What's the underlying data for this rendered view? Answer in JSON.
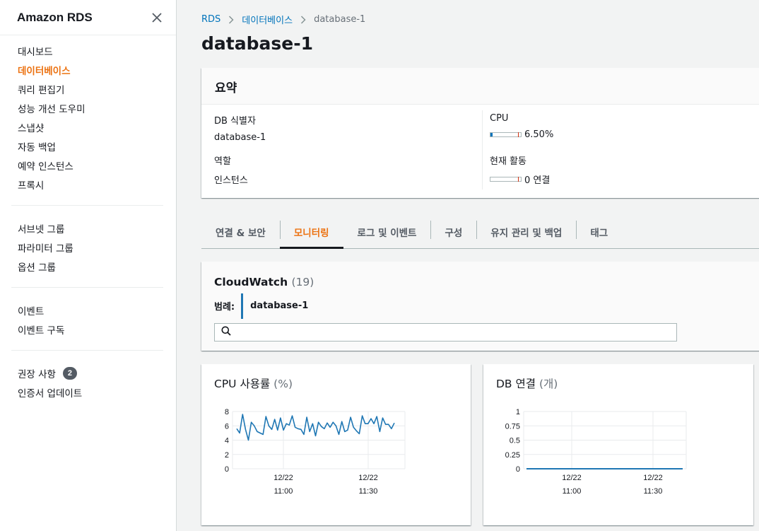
{
  "sidebar": {
    "title": "Amazon RDS",
    "groups": [
      [
        {
          "label": "대시보드"
        },
        {
          "label": "데이터베이스",
          "active": true
        },
        {
          "label": "쿼리 편집기"
        },
        {
          "label": "성능 개선 도우미"
        },
        {
          "label": "스냅샷"
        },
        {
          "label": "자동 백업"
        },
        {
          "label": "예약 인스턴스"
        },
        {
          "label": "프록시"
        }
      ],
      [
        {
          "label": "서브넷 그룹"
        },
        {
          "label": "파라미터 그룹"
        },
        {
          "label": "옵션 그룹"
        }
      ],
      [
        {
          "label": "이벤트"
        },
        {
          "label": "이벤트 구독"
        }
      ],
      [
        {
          "label": "권장 사항",
          "badge": "2"
        },
        {
          "label": "인증서 업데이트"
        }
      ]
    ]
  },
  "breadcrumb": {
    "items": [
      "RDS",
      "데이터베이스"
    ],
    "current": "database-1"
  },
  "page_title": "database-1",
  "summary": {
    "title": "요약",
    "db_id_label": "DB 식별자",
    "db_id_value": "database-1",
    "role_label": "역할",
    "role_value": "인스턴스",
    "cpu_label": "CPU",
    "cpu_value": "6.50%",
    "cpu_fraction": 0.065,
    "activity_label": "현재 활동",
    "activity_value": "0 연결",
    "activity_fraction": 0
  },
  "tabs": [
    {
      "label": "연결 & 보안"
    },
    {
      "label": "모니터링",
      "active": true
    },
    {
      "label": "로그 및 이벤트"
    },
    {
      "label": "구성"
    },
    {
      "label": "유지 관리 및 백업"
    },
    {
      "label": "태그"
    }
  ],
  "cloudwatch": {
    "title": "CloudWatch",
    "count": "(19)",
    "legend_label": "범례:",
    "legend_item": "database-1",
    "search_placeholder": ""
  },
  "colors": {
    "accent": "#ec7211",
    "link": "#0073bb",
    "series": "#1f77b4"
  },
  "chart_data": [
    {
      "type": "line",
      "title": "CPU 사용률",
      "unit": "(%)",
      "yticks": [
        "8",
        "6",
        "4",
        "2",
        "0"
      ],
      "ylim": [
        0,
        8
      ],
      "xticks": [
        {
          "date": "12/22",
          "time": "11:00"
        },
        {
          "date": "12/22",
          "time": "11:30"
        }
      ],
      "series": [
        {
          "values": [
            5.6,
            5.0,
            7.6,
            5.5,
            4.0,
            6.5,
            6.0,
            5.2,
            5.0,
            4.8,
            7.3,
            6.0,
            5.5,
            6.9,
            5.4,
            7.1,
            5.4,
            6.3,
            6.1,
            7.4,
            5.8,
            5.6,
            5.5,
            4.8,
            7.2,
            5.2,
            6.3,
            4.6,
            6.5,
            5.9,
            5.6,
            6.4,
            5.8,
            6.5,
            6.0,
            4.8,
            6.6,
            5.2,
            5.4,
            7.2,
            5.8,
            5.3,
            4.9,
            7.4,
            6.3,
            6.3,
            7.0,
            6.3,
            7.3,
            5.2,
            7.1,
            6.2,
            6.2,
            5.6,
            6.4
          ]
        }
      ]
    },
    {
      "type": "line",
      "title": "DB 연결",
      "unit": "(개)",
      "yticks": [
        "1",
        "0.75",
        "0.5",
        "0.25",
        "0"
      ],
      "ylim": [
        0,
        1
      ],
      "xticks": [
        {
          "date": "12/22",
          "time": "11:00"
        },
        {
          "date": "12/22",
          "time": "11:30"
        }
      ],
      "series": [
        {
          "values": [
            0,
            0,
            0,
            0,
            0,
            0,
            0,
            0,
            0,
            0,
            0,
            0,
            0,
            0,
            0,
            0,
            0,
            0,
            0,
            0
          ]
        }
      ]
    }
  ]
}
